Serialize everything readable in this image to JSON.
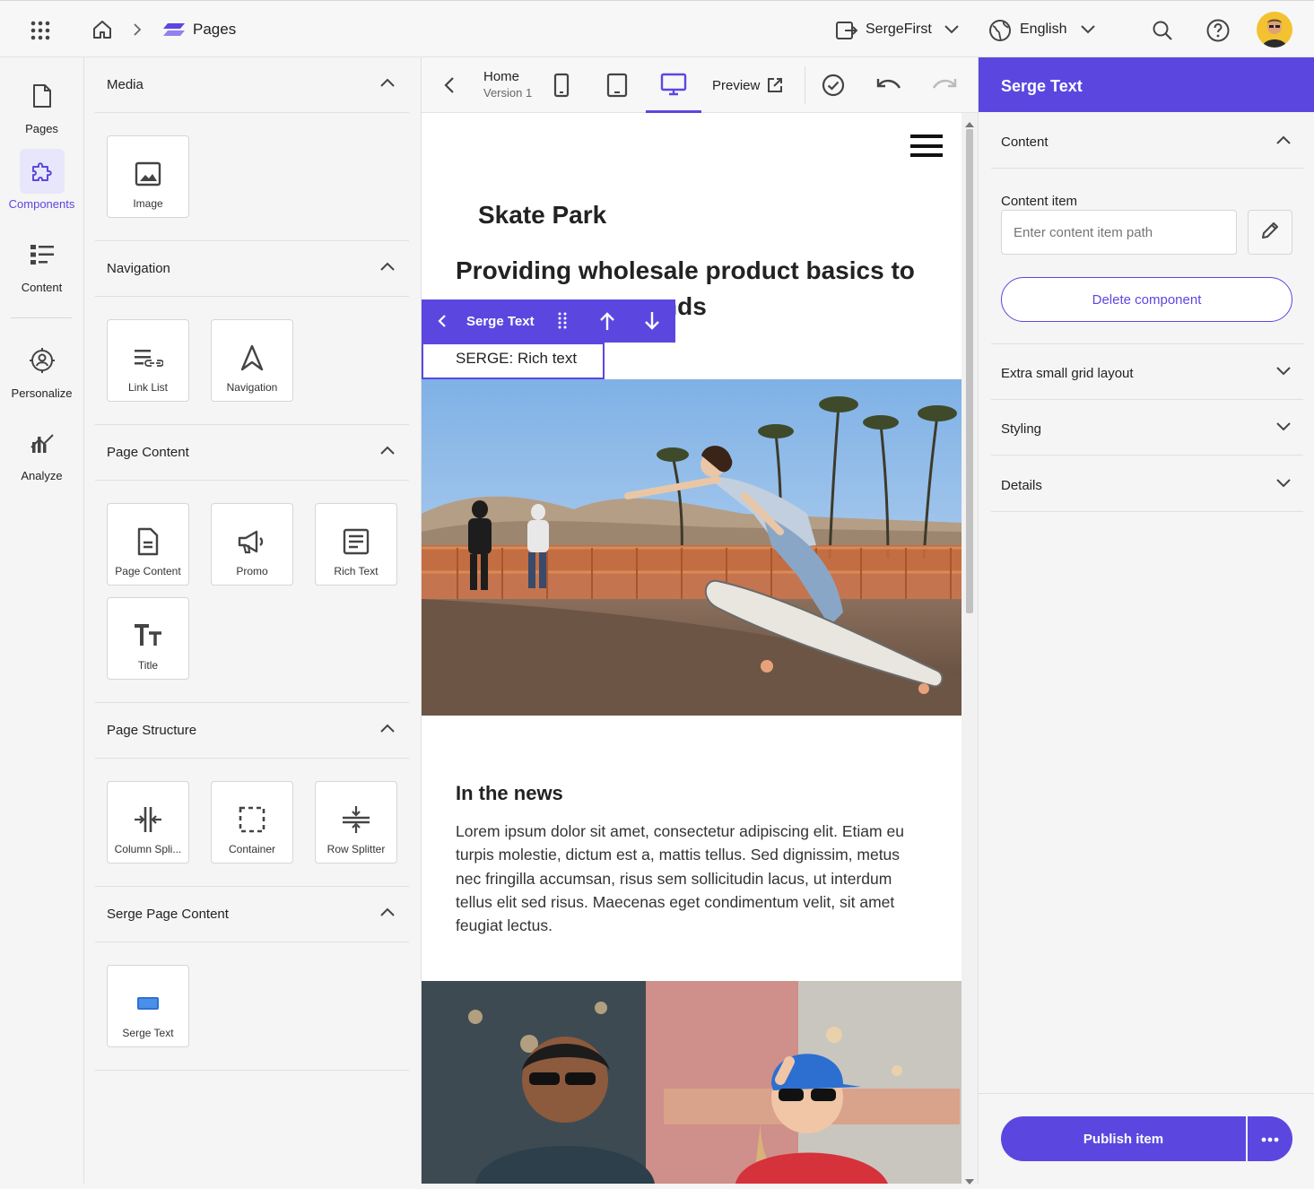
{
  "topbar": {
    "app_title": "Pages",
    "site_name": "SergeFirst",
    "language": "English"
  },
  "rail": {
    "items": [
      {
        "label": "Pages"
      },
      {
        "label": "Components"
      },
      {
        "label": "Content"
      },
      {
        "label": "Personalize"
      },
      {
        "label": "Analyze"
      }
    ]
  },
  "components": {
    "sections": [
      {
        "title": "Media",
        "items": [
          "Image"
        ]
      },
      {
        "title": "Navigation",
        "items": [
          "Link List",
          "Navigation"
        ]
      },
      {
        "title": "Page Content",
        "items": [
          "Page Content",
          "Promo",
          "Rich Text",
          "Title"
        ]
      },
      {
        "title": "Page Structure",
        "items": [
          "Column Spli...",
          "Container",
          "Row Splitter"
        ]
      },
      {
        "title": "Serge Page Content",
        "items": [
          "Serge Text"
        ]
      }
    ]
  },
  "toolbar": {
    "page_name": "Home",
    "version": "Version 1",
    "preview_label": "Preview"
  },
  "canvas": {
    "site_title": "Skate Park",
    "headline": "Providing wholesale product basics to",
    "headline_tail": "nds",
    "selected_component_label": "Serge Text",
    "rich_text": "SERGE: Rich text",
    "news_heading": "In the news",
    "news_body": "Lorem ipsum dolor sit amet, consectetur adipiscing elit. Etiam eu turpis molestie, dictum est a, mattis tellus. Sed dignissim, metus nec fringilla accumsan, risus sem sollicitudin lacus, ut interdum tellus elit sed risus. Maecenas eget condimentum velit, sit amet feugiat lectus."
  },
  "right_panel": {
    "title": "Serge Text",
    "content_section": "Content",
    "content_item_label": "Content item",
    "content_item_placeholder": "Enter content item path",
    "delete_label": "Delete component",
    "sections": [
      "Extra small grid layout",
      "Styling",
      "Details"
    ],
    "publish_label": "Publish item"
  },
  "colors": {
    "accent": "#5b47e0",
    "accent_light": "#e8e6fa"
  }
}
